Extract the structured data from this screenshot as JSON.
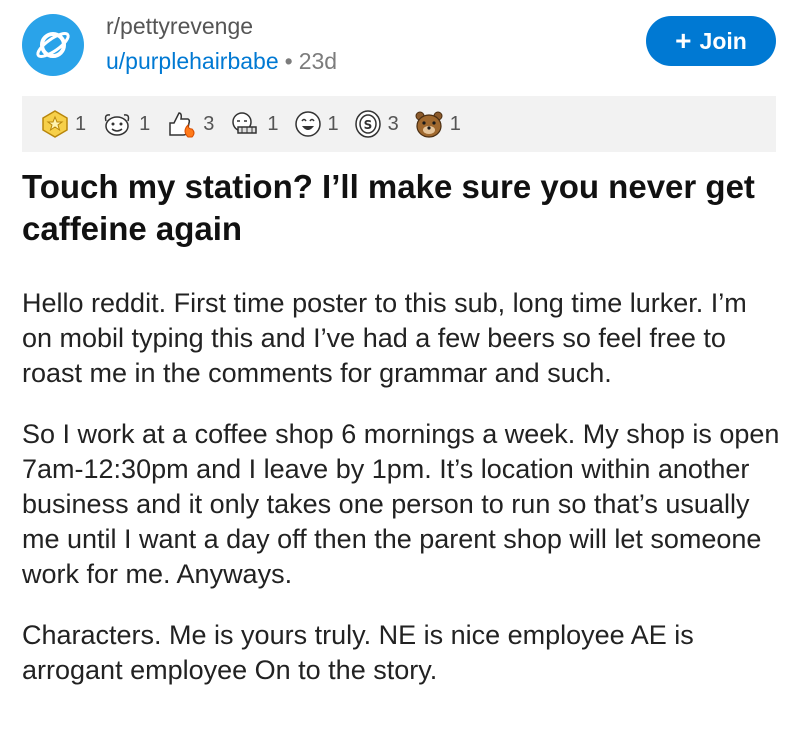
{
  "header": {
    "subreddit": "r/pettyrevenge",
    "author": "u/purplehairbabe",
    "separator": "•",
    "age": "23d",
    "join_label": "Join",
    "join_icon": "+"
  },
  "awards": [
    {
      "icon": "gold-medal-icon",
      "count": "1"
    },
    {
      "icon": "wholesome-icon",
      "count": "1"
    },
    {
      "icon": "fire-thumbs-up-icon",
      "count": "3"
    },
    {
      "icon": "hugz-icon",
      "count": "1"
    },
    {
      "icon": "happy-face-icon",
      "count": "1"
    },
    {
      "icon": "coin-icon",
      "count": "3"
    },
    {
      "icon": "bear-icon",
      "count": "1"
    }
  ],
  "post": {
    "title": "Touch my station? I’ll make sure you never get caffeine again",
    "paragraphs": [
      "Hello reddit. First time poster to this sub, long time lurker. I’m on mobil typing this and I’ve had a few beers so feel free to roast me in the comments for grammar and such.",
      "So I work at a coffee shop 6 mornings a week. My shop is open 7am-12:30pm and I leave by 1pm. It’s location within another business and it only takes one person to run so that’s usually me until I want a day off then the parent shop will let someone work for me. Anyways.",
      "Characters. Me is yours truly. NE is nice employee AE is arrogant employee On to the story."
    ]
  },
  "colors": {
    "accent": "#0079d3",
    "avatar": "#2aa3e9",
    "award_bar": "#f2f2f2"
  }
}
